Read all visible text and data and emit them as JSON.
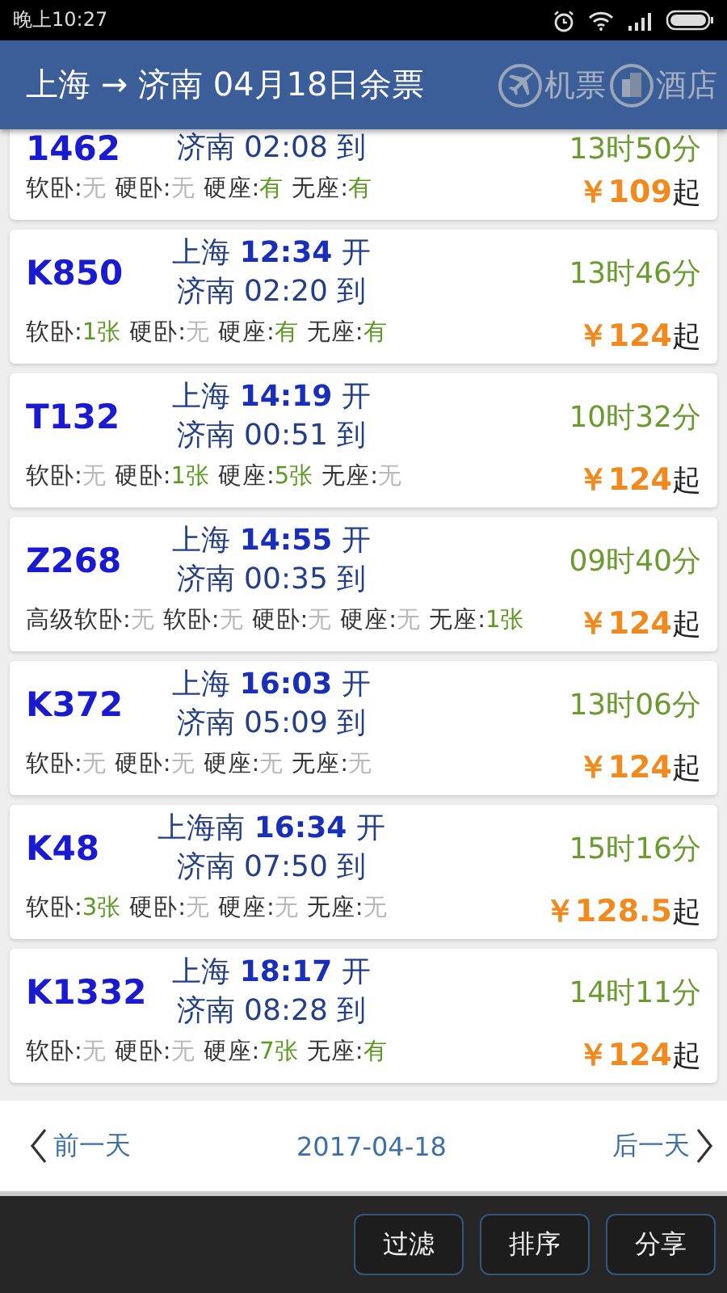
{
  "status_bar": {
    "time": "晚上10:27"
  },
  "header": {
    "title": "上海 → 济南 04月18日余票",
    "links": [
      {
        "kind": "flight",
        "label": "机票"
      },
      {
        "kind": "hotel",
        "label": "酒店"
      }
    ]
  },
  "trains": [
    {
      "train": "1462",
      "arrive": "济南 02:08 到",
      "duration": "13时50分",
      "price": "￥109",
      "price_suffix": "起",
      "seats": [
        {
          "type": "软卧:",
          "value": "无",
          "available": false
        },
        {
          "type": "硬卧:",
          "value": "无",
          "available": false
        },
        {
          "type": "硬座:",
          "value": "有",
          "available": true
        },
        {
          "type": "无座:",
          "value": "有",
          "available": true
        }
      ]
    },
    {
      "train": "K850",
      "depart": "上海 **12:34** 开",
      "arrive": "济南 02:20 到",
      "duration": "13时46分",
      "price": "￥124",
      "price_suffix": "起",
      "seats": [
        {
          "type": "软卧:",
          "value": "1张",
          "available": true
        },
        {
          "type": "硬卧:",
          "value": "无",
          "available": false
        },
        {
          "type": "硬座:",
          "value": "有",
          "available": true
        },
        {
          "type": "无座:",
          "value": "有",
          "available": true
        }
      ]
    },
    {
      "train": "T132",
      "depart": "上海 **14:19** 开",
      "arrive": "济南 00:51 到",
      "duration": "10时32分",
      "price": "￥124",
      "price_suffix": "起",
      "seats": [
        {
          "type": "软卧:",
          "value": "无",
          "available": false
        },
        {
          "type": "硬卧:",
          "value": "1张",
          "available": true
        },
        {
          "type": "硬座:",
          "value": "5张",
          "available": true
        },
        {
          "type": "无座:",
          "value": "无",
          "available": false
        }
      ]
    },
    {
      "train": "Z268",
      "depart": "上海 **14:55** 开",
      "arrive": "济南 00:35 到",
      "duration": "09时40分",
      "price": "￥124",
      "price_suffix": "起",
      "seats": [
        {
          "type": "高级软卧:",
          "value": "无",
          "available": false
        },
        {
          "type": "软卧:",
          "value": "无",
          "available": false
        },
        {
          "type": "硬卧:",
          "value": "无",
          "available": false
        },
        {
          "type": "硬座:",
          "value": "无",
          "available": false
        },
        {
          "type": "无座:",
          "value": "1张",
          "available": true
        }
      ]
    },
    {
      "train": "K372",
      "depart": "上海 **16:03** 开",
      "arrive": "济南 05:09 到",
      "duration": "13时06分",
      "price": "￥124",
      "price_suffix": "起",
      "seats": [
        {
          "type": "软卧:",
          "value": "无",
          "available": false
        },
        {
          "type": "硬卧:",
          "value": "无",
          "available": false
        },
        {
          "type": "硬座:",
          "value": "无",
          "available": false
        },
        {
          "type": "无座:",
          "value": "无",
          "available": false
        }
      ]
    },
    {
      "train": "K48",
      "depart": "上海南 **16:34** 开",
      "arrive": "济南 07:50 到",
      "duration": "15时16分",
      "price": "￥128.5",
      "price_suffix": "起",
      "seats": [
        {
          "type": "软卧:",
          "value": "3张",
          "available": true
        },
        {
          "type": "硬卧:",
          "value": "无",
          "available": false
        },
        {
          "type": "硬座:",
          "value": "无",
          "available": false
        },
        {
          "type": "无座:",
          "value": "无",
          "available": false
        }
      ]
    },
    {
      "train": "K1332",
      "depart": "上海 **18:17** 开",
      "arrive": "济南 08:28 到",
      "duration": "14时11分",
      "price": "￥124",
      "price_suffix": "起",
      "seats": [
        {
          "type": "软卧:",
          "value": "无",
          "available": false
        },
        {
          "type": "硬卧:",
          "value": "无",
          "available": false
        },
        {
          "type": "硬座:",
          "value": "7张",
          "available": true
        },
        {
          "type": "无座:",
          "value": "有",
          "available": true
        }
      ]
    }
  ],
  "date_nav": {
    "prev": "前一天",
    "date": "2017-04-18",
    "next": "后一天"
  },
  "toolbar": {
    "buttons": [
      "过滤",
      "排序",
      "分享"
    ]
  }
}
